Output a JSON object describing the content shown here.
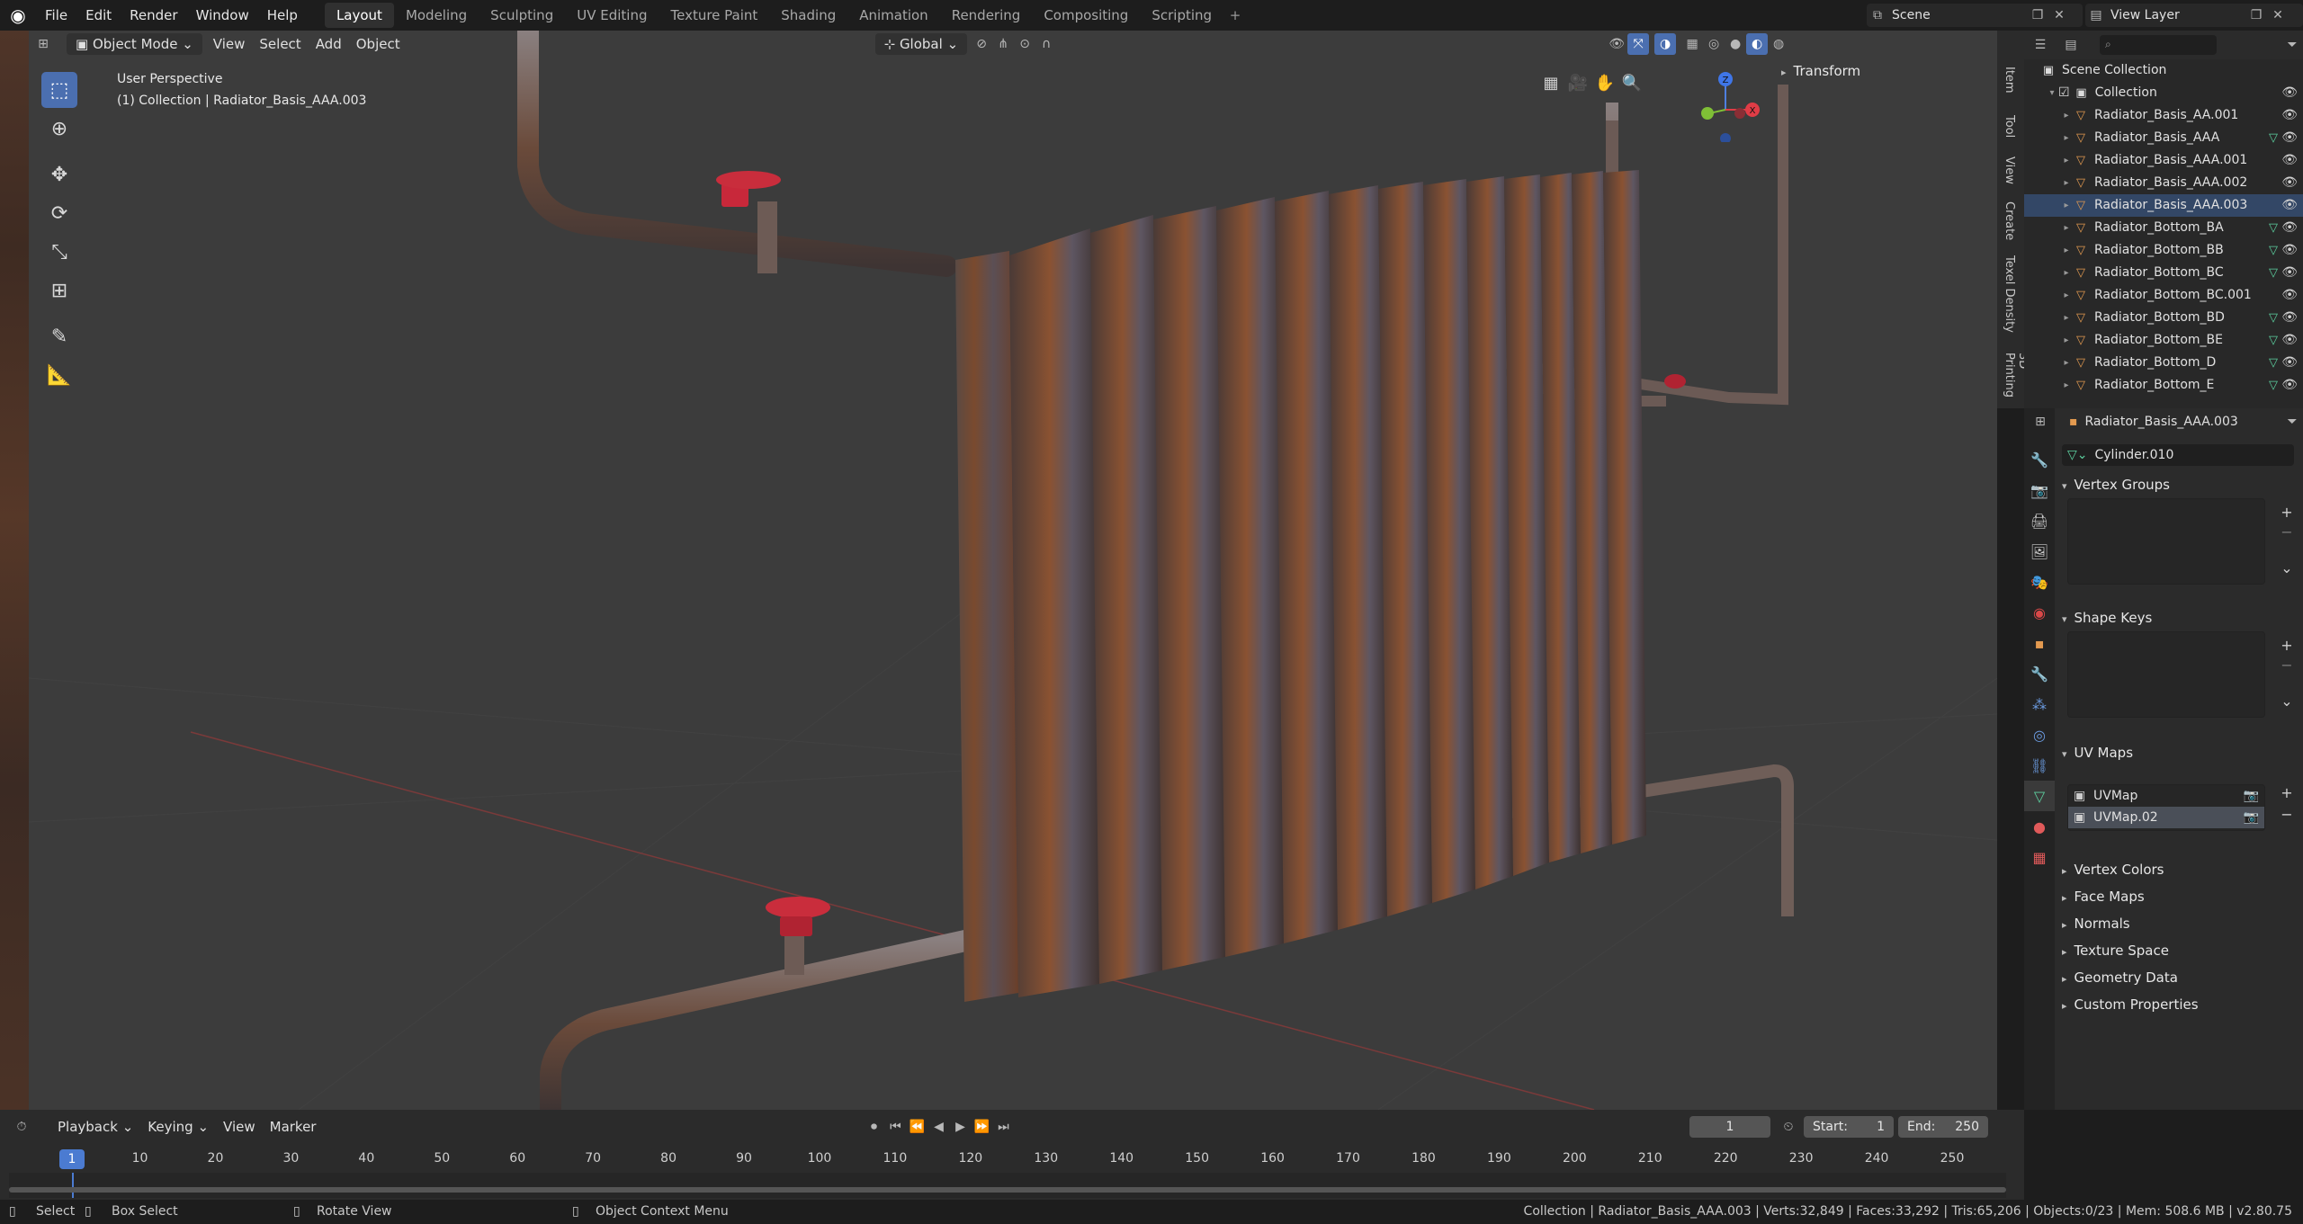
{
  "menu": [
    "File",
    "Edit",
    "Render",
    "Window",
    "Help"
  ],
  "workspaces": [
    "Layout",
    "Modeling",
    "Sculpting",
    "UV Editing",
    "Texture Paint",
    "Shading",
    "Animation",
    "Rendering",
    "Compositing",
    "Scripting"
  ],
  "scene_name": "Scene",
  "view_layer": "View Layer",
  "viewport": {
    "mode": "Object Mode",
    "menus": [
      "View",
      "Select",
      "Add",
      "Object"
    ],
    "orientation": "Global",
    "perspective_label": "User Perspective",
    "collection_label": "(1) Collection | Radiator_Basis_AAA.003",
    "npanel_section": "Transform",
    "side_tabs": [
      "Item",
      "Tool",
      "View",
      "Create",
      "Texel Density",
      "3D Printing"
    ],
    "gizmo_axes": {
      "z": "Z",
      "x": "X"
    }
  },
  "outliner": {
    "root": "Scene Collection",
    "collection": "Collection",
    "items": [
      {
        "name": "Radiator_Basis_AA.001",
        "mod": false,
        "selected": false
      },
      {
        "name": "Radiator_Basis_AAA",
        "mod": true,
        "selected": false
      },
      {
        "name": "Radiator_Basis_AAA.001",
        "mod": false,
        "selected": false
      },
      {
        "name": "Radiator_Basis_AAA.002",
        "mod": false,
        "selected": false
      },
      {
        "name": "Radiator_Basis_AAA.003",
        "mod": false,
        "selected": true
      },
      {
        "name": "Radiator_Bottom_BA",
        "mod": true,
        "selected": false
      },
      {
        "name": "Radiator_Bottom_BB",
        "mod": true,
        "selected": false
      },
      {
        "name": "Radiator_Bottom_BC",
        "mod": true,
        "selected": false
      },
      {
        "name": "Radiator_Bottom_BC.001",
        "mod": false,
        "selected": false
      },
      {
        "name": "Radiator_Bottom_BD",
        "mod": true,
        "selected": false
      },
      {
        "name": "Radiator_Bottom_BE",
        "mod": true,
        "selected": false
      },
      {
        "name": "Radiator_Bottom_D",
        "mod": true,
        "selected": false
      },
      {
        "name": "Radiator_Bottom_E",
        "mod": true,
        "selected": false
      }
    ]
  },
  "properties": {
    "object_name": "Radiator_Basis_AAA.003",
    "mesh_name": "Cylinder.010",
    "sections_open": [
      "Vertex Groups",
      "Shape Keys",
      "UV Maps"
    ],
    "uv_maps": [
      "UVMap",
      "UVMap.02"
    ],
    "sections_closed": [
      "Vertex Colors",
      "Face Maps",
      "Normals",
      "Texture Space",
      "Geometry Data",
      "Custom Properties"
    ]
  },
  "timeline": {
    "menus": [
      "Playback",
      "Keying",
      "View",
      "Marker"
    ],
    "current_frame": "1",
    "start_label": "Start:",
    "start": "1",
    "end_label": "End:",
    "end": "250",
    "ticks": [
      "10",
      "20",
      "30",
      "40",
      "50",
      "60",
      "70",
      "80",
      "90",
      "100",
      "110",
      "120",
      "130",
      "140",
      "150",
      "160",
      "170",
      "180",
      "190",
      "200",
      "210",
      "220",
      "230",
      "240",
      "250"
    ]
  },
  "status": {
    "select": "Select",
    "box_select": "Box Select",
    "rotate": "Rotate View",
    "context": "Object Context Menu",
    "stats": "Collection | Radiator_Basis_AAA.003 | Verts:32,849 | Faces:33,292 | Tris:65,206 | Objects:0/23 | Mem: 508.6 MB | v2.80.75"
  }
}
